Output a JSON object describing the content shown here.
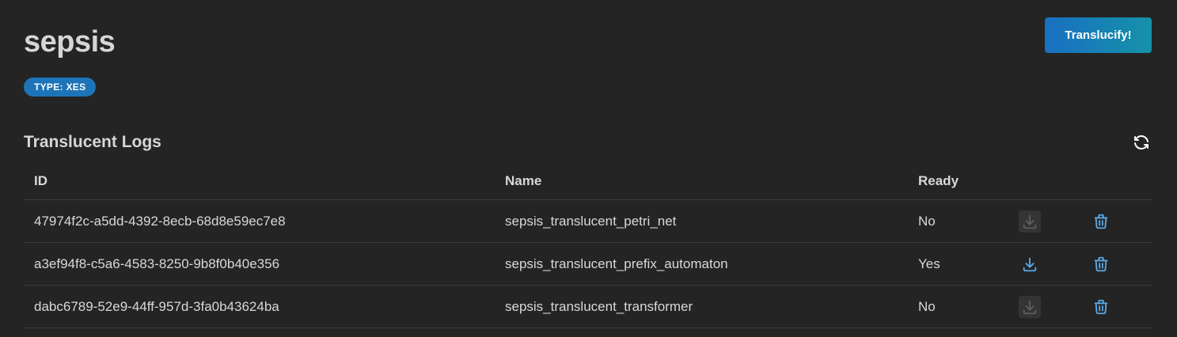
{
  "header": {
    "title": "sepsis",
    "type_badge": "TYPE: XES",
    "translucify_label": "Translucify!"
  },
  "section": {
    "title": "Translucent Logs",
    "refresh_icon": "refresh-icon"
  },
  "table": {
    "columns": [
      "ID",
      "Name",
      "Ready"
    ],
    "rows": [
      {
        "id": "47974f2c-a5dd-4392-8ecb-68d8e59ec7e8",
        "name": "sepsis_translucent_petri_net",
        "ready": "No",
        "download_enabled": false
      },
      {
        "id": "a3ef94f8-c5a6-4583-8250-9b8f0b40e356",
        "name": "sepsis_translucent_prefix_automaton",
        "ready": "Yes",
        "download_enabled": true
      },
      {
        "id": "dabc6789-52e9-44ff-957d-3fa0b43624ba",
        "name": "sepsis_translucent_transformer",
        "ready": "No",
        "download_enabled": false
      }
    ]
  },
  "colors": {
    "background": "#242424",
    "accent": "#1d74b8",
    "icon_active": "#5aa9e6",
    "icon_disabled": "#5e5e5e"
  }
}
